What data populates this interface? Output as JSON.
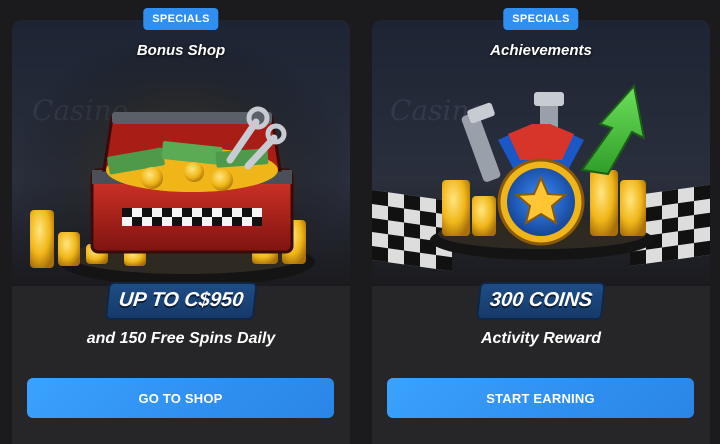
{
  "cards": [
    {
      "badge": "SPECIALS",
      "title": "Bonus Shop",
      "amount": "UP TO C$950",
      "subtitle": "and 150 Free Spins Daily",
      "button": "GO TO SHOP",
      "art_icon": "treasure-chest-icon"
    },
    {
      "badge": "SPECIALS",
      "title": "Achievements",
      "amount": "300 COINS",
      "subtitle": "Activity Reward",
      "button": "START EARNING",
      "art_icon": "star-medal-icon"
    }
  ],
  "colors": {
    "accent": "#2f8ff0",
    "card_bg": "#262629",
    "page_bg": "#1b1b1e",
    "amount_bg": "#1e4d86"
  }
}
